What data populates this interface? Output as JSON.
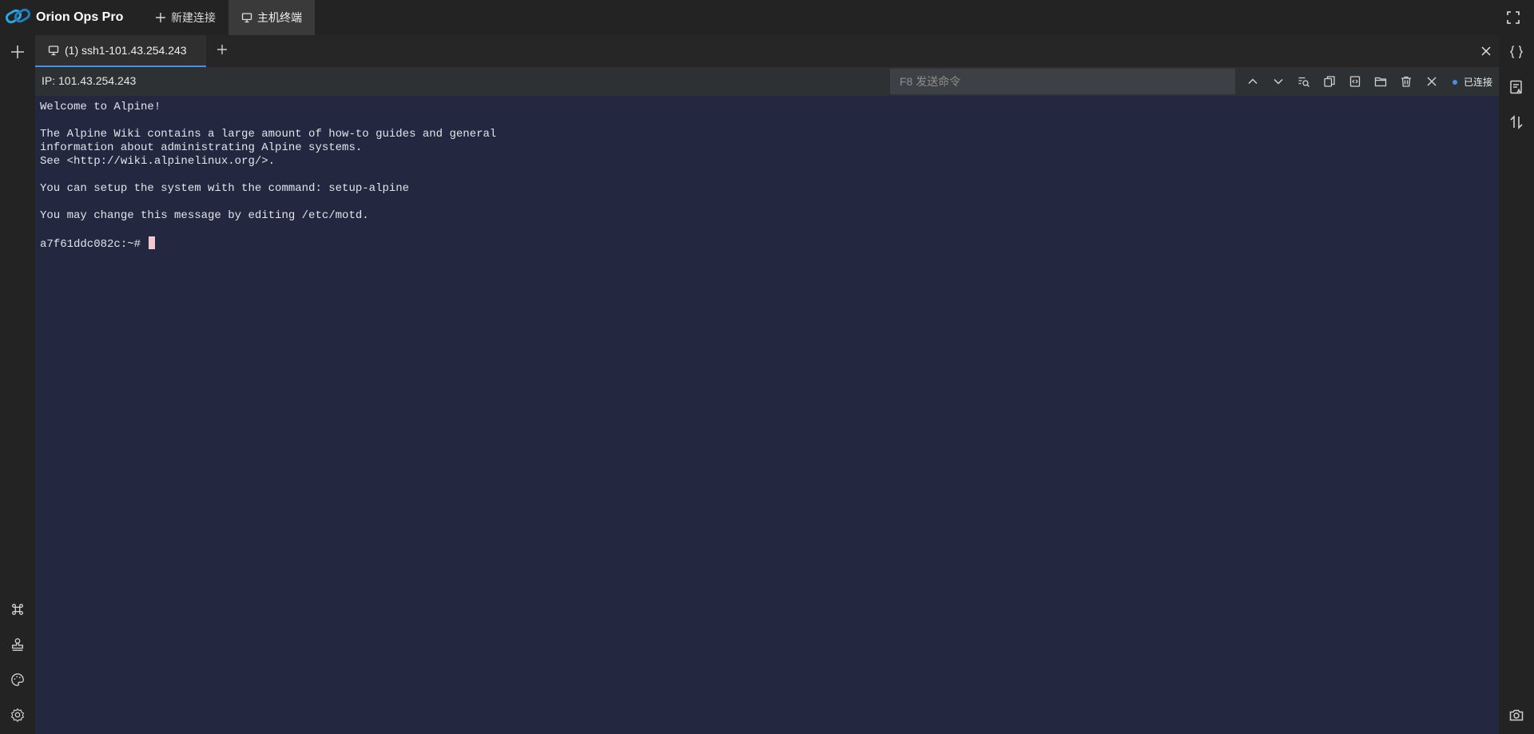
{
  "app": {
    "name": "Orion Ops Pro",
    "brand_color": "#29a8e0"
  },
  "top_tabs": [
    {
      "label": "新建连接",
      "icon": "plus-icon",
      "active": false
    },
    {
      "label": "主机终端",
      "icon": "monitor-icon",
      "active": true
    }
  ],
  "terminal_tabs": [
    {
      "label": "(1) ssh1-101.43.254.243",
      "icon": "monitor-icon",
      "active": true
    }
  ],
  "toolbar": {
    "ip_label": "IP: 101.43.254.243",
    "command_placeholder": "F8 发送命令",
    "status": "已连接",
    "status_color": "#4a8fe6",
    "icons": [
      "chevron-up-icon",
      "chevron-down-icon",
      "search-icon",
      "copy-icon",
      "paste-icon",
      "folder-icon",
      "delete-icon",
      "disconnect-icon"
    ]
  },
  "terminal": {
    "background": "#232840",
    "lines": [
      "Welcome to Alpine!",
      "",
      "The Alpine Wiki contains a large amount of how-to guides and general",
      "information about administrating Alpine systems.",
      "See <http://wiki.alpinelinux.org/>.",
      "",
      "You can setup the system with the command: setup-alpine",
      "",
      "You may change this message by editing /etc/motd.",
      ""
    ],
    "prompt": "a7f61ddc082c:~# "
  },
  "left_rail": {
    "top_icons": [
      "plus-icon"
    ],
    "bottom_icons": [
      "command-icon",
      "stamp-icon",
      "palette-icon",
      "settings-icon"
    ]
  },
  "right_rail": {
    "top_icons": [
      "braces-icon",
      "script-icon",
      "transfer-icon"
    ],
    "bottom_icons": [
      "camera-icon"
    ]
  }
}
